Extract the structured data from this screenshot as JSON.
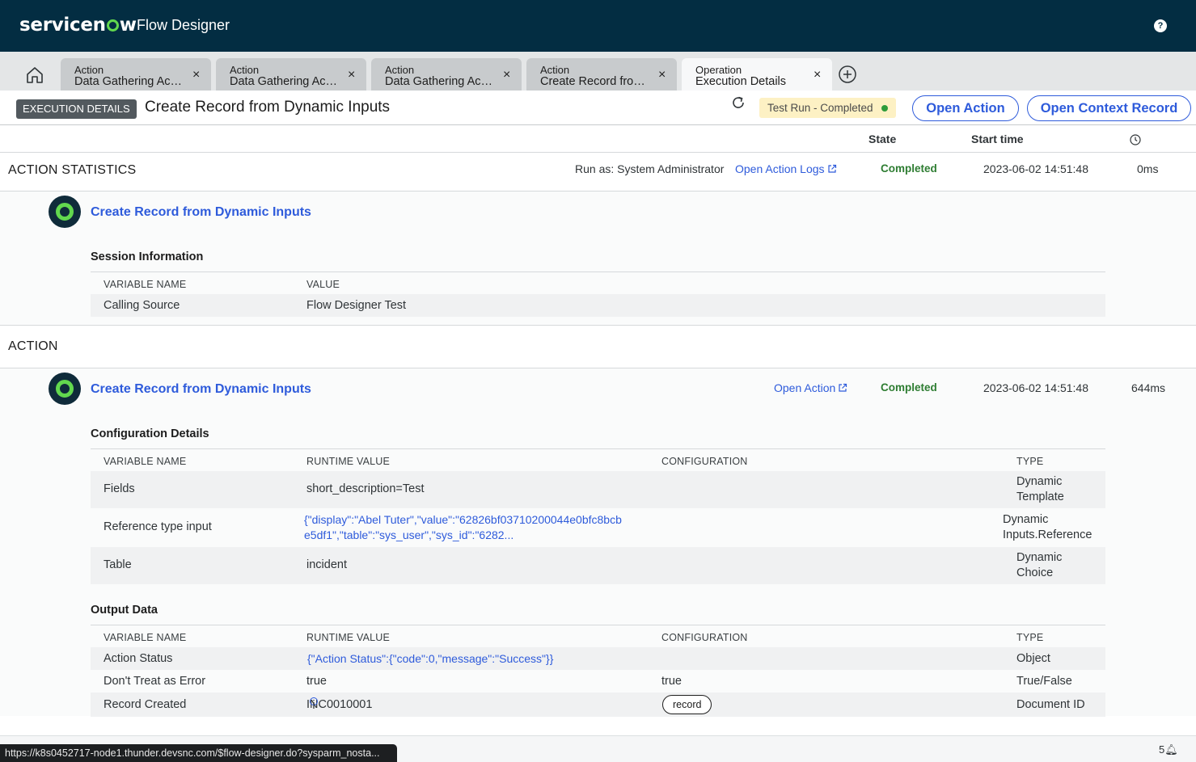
{
  "topbar": {
    "logo_left": "servicen",
    "logo_right": "w",
    "app_name": "Flow Designer",
    "help_glyph": "?"
  },
  "tabs": [
    {
      "kind": "Action",
      "title": "Data Gathering Acti...",
      "close": "×"
    },
    {
      "kind": "Action",
      "title": "Data Gathering Acti...",
      "close": "×"
    },
    {
      "kind": "Action",
      "title": "Data Gathering Acti...",
      "close": "×"
    },
    {
      "kind": "Action",
      "title": "Create Record from ...",
      "close": "×"
    },
    {
      "kind": "Operation",
      "title": "Execution Details",
      "close": "×",
      "active": true
    }
  ],
  "header": {
    "badge": "EXECUTION DETAILS",
    "title": "Create Record from Dynamic Inputs",
    "status": "Test Run - Completed",
    "open_action": "Open Action",
    "open_context_record": "Open Context Record"
  },
  "columns": {
    "state": "State",
    "start_time": "Start time"
  },
  "stats": {
    "section_title": "ACTION STATISTICS",
    "run_as": "Run as: System Administrator",
    "logs_link": "Open Action Logs",
    "state": "Completed",
    "start": "2023-06-02 14:51:48",
    "duration": "0ms",
    "step_title": "Create Record from Dynamic Inputs",
    "session_heading": "Session Information",
    "session_cols": [
      "VARIABLE NAME",
      "VALUE"
    ],
    "session_rows": [
      {
        "name": "Calling Source",
        "value": "Flow Designer Test"
      }
    ]
  },
  "action": {
    "section_title": "ACTION",
    "step_title": "Create Record from Dynamic Inputs",
    "open_action_link": "Open Action",
    "state": "Completed",
    "start": "2023-06-02 14:51:48",
    "duration": "644ms",
    "config_heading": "Configuration Details",
    "config_cols": [
      "VARIABLE NAME",
      "RUNTIME VALUE",
      "CONFIGURATION",
      "TYPE"
    ],
    "config_rows": [
      {
        "name": "Fields",
        "value": "short_description=Test",
        "config": "",
        "type_line1": "Dynamic",
        "type_line2": "Template"
      },
      {
        "name": "Reference type input",
        "value_line1": "{\"display\":\"Abel Tuter\",\"value\":\"62826bf03710200044e0bfc8bcb",
        "value_line2": "e5df1\",\"table\":\"sys_user\",\"sys_id\":\"6282...",
        "config": "",
        "type_line1": "Dynamic",
        "type_line2": "Inputs.Reference"
      },
      {
        "name": "Table",
        "value": "incident",
        "config": "",
        "type_line1": "Dynamic",
        "type_line2": "Choice"
      }
    ],
    "output_heading": "Output Data",
    "output_cols": [
      "VARIABLE NAME",
      "RUNTIME VALUE",
      "CONFIGURATION",
      "TYPE"
    ],
    "output_rows": [
      {
        "name": "Action Status",
        "value": "{\"Action Status\":{\"code\":0,\"message\":\"Success\"}}",
        "config": "",
        "type": "Object"
      },
      {
        "name": "Don't Treat as Error",
        "value": "true",
        "config": "true",
        "type": "True/False"
      },
      {
        "name": "Record Created",
        "value": "INC0010001",
        "config": "record",
        "type": "Document ID"
      }
    ]
  },
  "statusbar": {
    "url": "https://k8s0452717-node1.thunder.devsnc.com/$flow-designer.do?sysparm_nosta...",
    "notifications": "5"
  }
}
